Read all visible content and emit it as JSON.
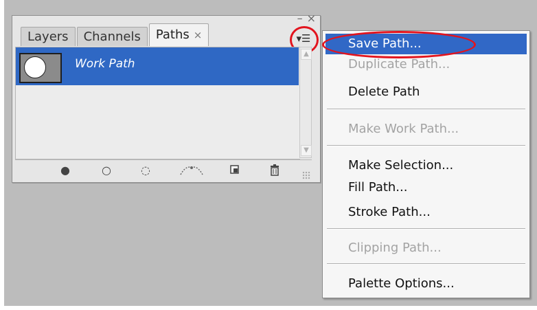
{
  "palette": {
    "tabs": [
      {
        "label": "Layers"
      },
      {
        "label": "Channels"
      },
      {
        "label": "Paths",
        "close": "×"
      }
    ],
    "controls": {
      "minimize": "–",
      "close": "×"
    },
    "menu_button": "▾☰",
    "paths": [
      {
        "name": "Work Path"
      }
    ],
    "tools": [
      {
        "icon": "fill-path-icon"
      },
      {
        "icon": "stroke-path-icon"
      },
      {
        "icon": "load-selection-icon"
      },
      {
        "icon": "make-work-path-icon"
      },
      {
        "icon": "new-path-icon"
      },
      {
        "icon": "delete-path-icon"
      }
    ]
  },
  "flyout": {
    "items": [
      {
        "label": "Save Path...",
        "state": "highlighted"
      },
      {
        "label": "Duplicate Path...",
        "state": "disabled"
      },
      {
        "label": "Delete Path",
        "state": "enabled"
      },
      {
        "label": "Make Work Path...",
        "state": "disabled"
      },
      {
        "label": "Make Selection...",
        "state": "enabled"
      },
      {
        "label": "Fill Path...",
        "state": "enabled"
      },
      {
        "label": "Stroke Path...",
        "state": "enabled"
      },
      {
        "label": "Clipping Path...",
        "state": "disabled"
      },
      {
        "label": "Palette Options...",
        "state": "enabled"
      }
    ]
  },
  "colors": {
    "selection": "#3168c6",
    "annotation": "#e2141e",
    "disabled_text": "#a3a3a3"
  }
}
